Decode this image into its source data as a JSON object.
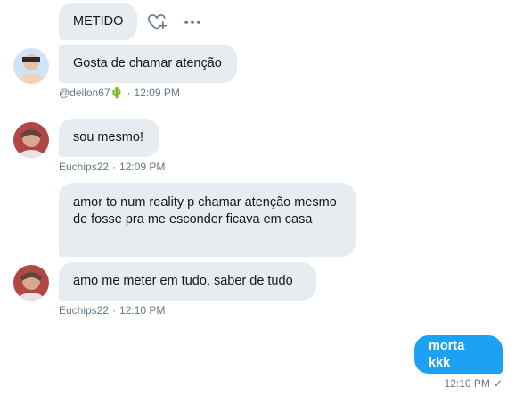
{
  "messages": [
    {
      "id": "m1",
      "text": "METIDO"
    },
    {
      "id": "m2",
      "text": "Gosta de chamar atenção",
      "meta": {
        "user": "@deilon67",
        "emoji": "🌵",
        "time": "12:09 PM"
      }
    },
    {
      "id": "m3",
      "text": "sou mesmo!",
      "meta": {
        "user": "Euchips22",
        "time": "12:09 PM"
      }
    },
    {
      "id": "m4",
      "text": "amor to num reality p chamar atenção mesmo de fosse pra me esconder ficava em casa"
    },
    {
      "id": "m5",
      "text": "amo me meter em tudo, saber de tudo",
      "meta": {
        "user": "Euchips22",
        "time": "12:10 PM"
      }
    },
    {
      "id": "m6",
      "text": "morta kkk",
      "meta": {
        "time": "12:10 PM",
        "status": "✓"
      }
    }
  ],
  "separator": "·",
  "icons": {
    "react": "heart-plus-icon",
    "more": "more-horizontal-icon",
    "read": "check-icon"
  },
  "colors": {
    "accent": "#1da1f2",
    "bubble": "#e6ecf0",
    "meta": "#657786"
  }
}
